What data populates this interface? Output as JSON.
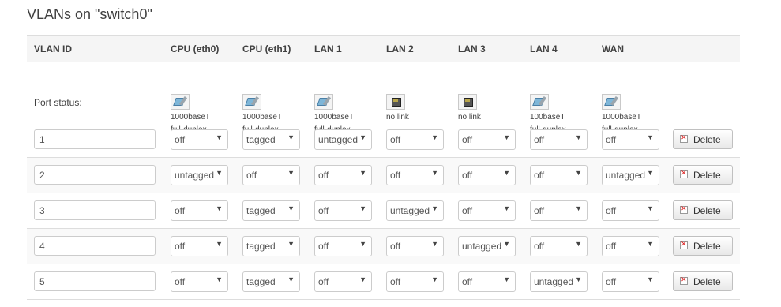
{
  "title": "VLANs on \"switch0\"",
  "columns": [
    "VLAN ID",
    "CPU (eth0)",
    "CPU (eth1)",
    "LAN 1",
    "LAN 2",
    "LAN 3",
    "LAN 4",
    "WAN"
  ],
  "port_status_label": "Port status:",
  "ports": [
    {
      "name": "CPU (eth0)",
      "icon": "ethernet-connected-icon",
      "link": true,
      "line1": "1000baseT",
      "line2": "full-duplex"
    },
    {
      "name": "CPU (eth1)",
      "icon": "ethernet-connected-icon",
      "link": true,
      "line1": "1000baseT",
      "line2": "full-duplex"
    },
    {
      "name": "LAN 1",
      "icon": "ethernet-connected-icon",
      "link": true,
      "line1": "1000baseT",
      "line2": "full-duplex"
    },
    {
      "name": "LAN 2",
      "icon": "ethernet-disconnected-icon",
      "link": false,
      "line1": "no link",
      "line2": ""
    },
    {
      "name": "LAN 3",
      "icon": "ethernet-disconnected-icon",
      "link": false,
      "line1": "no link",
      "line2": ""
    },
    {
      "name": "LAN 4",
      "icon": "ethernet-connected-icon",
      "link": true,
      "line1": "100baseT",
      "line2": "full-duplex"
    },
    {
      "name": "WAN",
      "icon": "ethernet-connected-icon",
      "link": true,
      "line1": "1000baseT",
      "line2": "full-duplex"
    }
  ],
  "dropdown_arrow": "▼",
  "delete_label": "Delete",
  "vlans": [
    {
      "id": "1",
      "ports": [
        "off",
        "tagged",
        "untagged",
        "off",
        "off",
        "off",
        "off"
      ]
    },
    {
      "id": "2",
      "ports": [
        "untagged",
        "off",
        "off",
        "off",
        "off",
        "off",
        "untagged"
      ]
    },
    {
      "id": "3",
      "ports": [
        "off",
        "tagged",
        "off",
        "untagged",
        "off",
        "off",
        "off"
      ]
    },
    {
      "id": "4",
      "ports": [
        "off",
        "tagged",
        "off",
        "off",
        "untagged",
        "off",
        "off"
      ]
    },
    {
      "id": "5",
      "ports": [
        "off",
        "tagged",
        "off",
        "off",
        "off",
        "untagged",
        "off"
      ]
    }
  ]
}
